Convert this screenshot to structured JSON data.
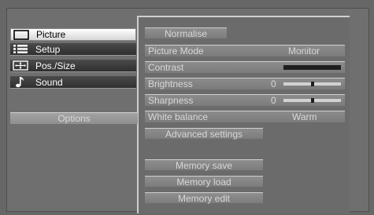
{
  "sidebar": {
    "items": [
      {
        "label": "Picture",
        "icon": "monitor-icon",
        "selected": true
      },
      {
        "label": "Setup",
        "icon": "list-icon",
        "selected": false
      },
      {
        "label": "Pos./Size",
        "icon": "position-size-icon",
        "selected": false
      },
      {
        "label": "Sound",
        "icon": "music-note-icon",
        "selected": false
      }
    ],
    "options_label": "Options"
  },
  "picture_menu": {
    "normalise_label": "Normalise",
    "rows": [
      {
        "label": "Picture Mode",
        "value": "Monitor"
      },
      {
        "label": "Contrast",
        "value": "",
        "level": 1.0
      },
      {
        "label": "Brightness",
        "value": "0",
        "level": 0.5
      },
      {
        "label": "Sharpness",
        "value": "0",
        "level": 0.5
      },
      {
        "label": "White balance",
        "value": "Warm"
      }
    ],
    "advanced_label": "Advanced settings",
    "memory_save_label": "Memory save",
    "memory_load_label": "Memory load",
    "memory_edit_label": "Memory edit"
  }
}
